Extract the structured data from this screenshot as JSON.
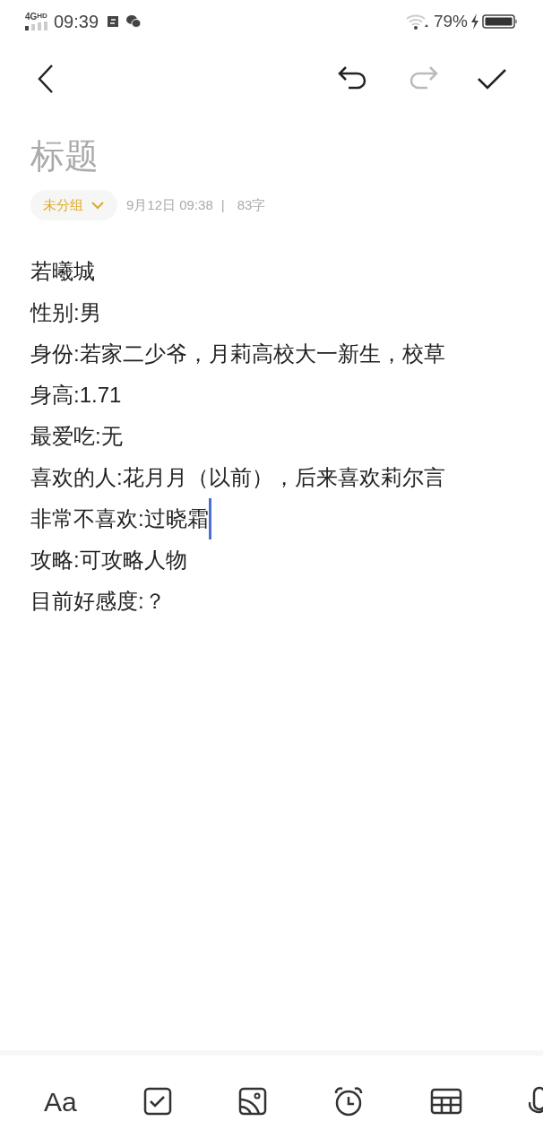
{
  "status_bar": {
    "network": "4G",
    "network_badge": "HD",
    "time": "09:39",
    "battery": "79%",
    "charging": true
  },
  "nav": {
    "redo_disabled": true
  },
  "title": {
    "placeholder": "标题"
  },
  "meta": {
    "group": "未分组",
    "date": "9月12日 09:38",
    "separator": "|",
    "count": "83字"
  },
  "body": [
    {
      "text": "若曦城",
      "cursor": false
    },
    {
      "text": "性别:男",
      "cursor": false
    },
    {
      "text": "身份:若家二少爷，月莉高校大一新生，校草",
      "cursor": false
    },
    {
      "text": "身高:1.71",
      "cursor": false
    },
    {
      "text": "最爱吃:无",
      "cursor": false
    },
    {
      "text": "喜欢的人:花月月（以前），后来喜欢莉尔言",
      "cursor": false
    },
    {
      "text": "非常不喜欢:过晓霜",
      "cursor": true
    },
    {
      "text": "攻略:可攻略人物",
      "cursor": false
    },
    {
      "text": "目前好感度:？",
      "cursor": false
    }
  ],
  "toolbar": {
    "format_label": "Aa"
  }
}
